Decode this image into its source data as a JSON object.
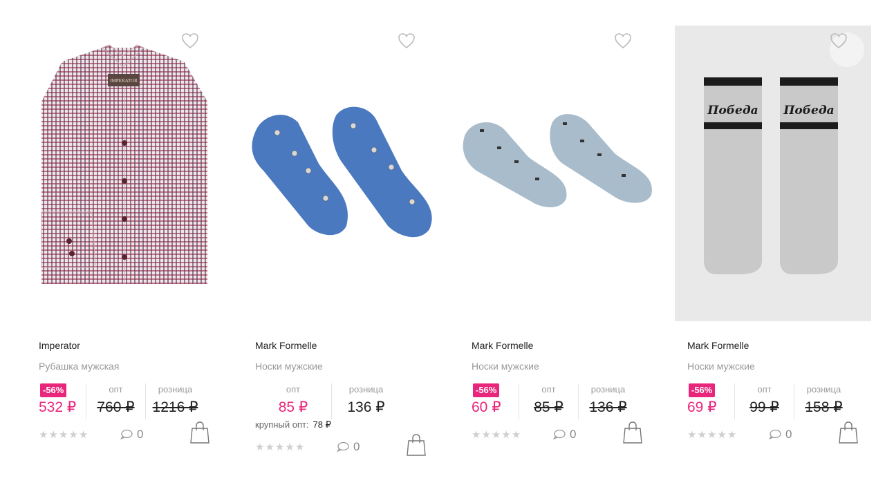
{
  "accent_color": "#e8267c",
  "labels": {
    "opt": "опт",
    "retail": "розница",
    "bulk": "крупный опт:"
  },
  "products": [
    {
      "brand": "Imperator",
      "type": "Рубашка мужская",
      "discount": "-56%",
      "opt_price": "532 ₽",
      "opt_old": "760 ₽",
      "retail_old": "1216 ₽",
      "rating": 0,
      "comments": "0",
      "image": "shirt"
    },
    {
      "brand": "Mark Formelle",
      "type": "Носки мужские",
      "opt_price": "85 ₽",
      "retail": "136 ₽",
      "bulk_price": "78 ₽",
      "rating": 0,
      "comments": "0",
      "image": "socks-blue"
    },
    {
      "brand": "Mark Formelle",
      "type": "Носки мужские",
      "discount": "-56%",
      "opt_price": "60 ₽",
      "opt_old": "85 ₽",
      "retail_old": "136 ₽",
      "rating": 0,
      "comments": "0",
      "image": "socks-grey"
    },
    {
      "brand": "Mark Formelle",
      "type": "Носки мужские",
      "discount": "-56%",
      "opt_price": "69 ₽",
      "opt_old": "99 ₽",
      "retail_old": "158 ₽",
      "rating": 0,
      "comments": "0",
      "image": "socks-pobeda",
      "image_text": "Победа",
      "shirt_label": "IMPERATOR"
    }
  ],
  "icons": {
    "favorite": "heart-icon",
    "comment": "comment-icon",
    "cart": "shopping-bag-icon",
    "rating": "star-icon"
  }
}
